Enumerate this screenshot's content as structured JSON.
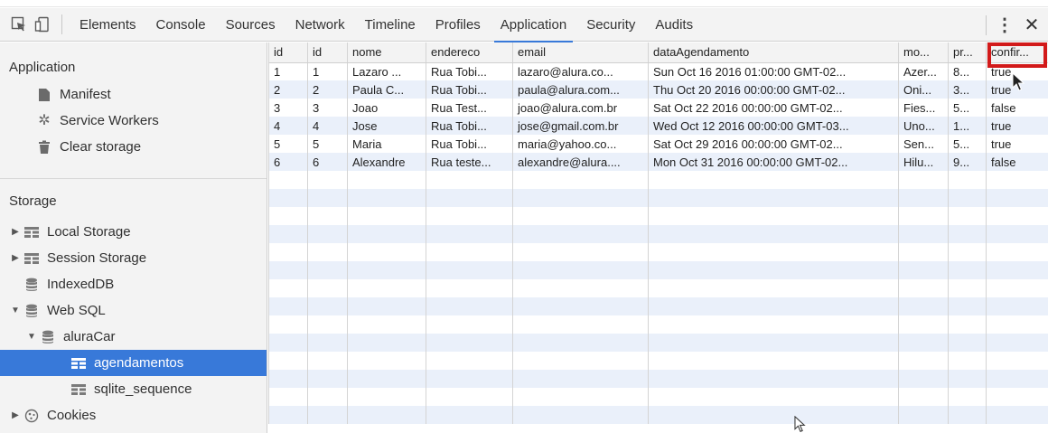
{
  "toolbar": {
    "tabs": [
      "Elements",
      "Console",
      "Sources",
      "Network",
      "Timeline",
      "Profiles",
      "Application",
      "Security",
      "Audits"
    ],
    "active_tab": "Application"
  },
  "sidebar": {
    "application_title": "Application",
    "application_items": [
      "Manifest",
      "Service Workers",
      "Clear storage"
    ],
    "storage_title": "Storage",
    "storage_items": {
      "local_storage": "Local Storage",
      "session_storage": "Session Storage",
      "indexeddb": "IndexedDB",
      "web_sql": "Web SQL",
      "database": "aluraCar",
      "table_selected": "agendamentos",
      "table_other": "sqlite_sequence",
      "cookies": "Cookies"
    }
  },
  "grid": {
    "columns": [
      "id",
      "id",
      "nome",
      "endereco",
      "email",
      "dataAgendamento",
      "mo...",
      "pr...",
      "confir..."
    ],
    "rows": [
      [
        "1",
        "1",
        "Lazaro ...",
        "Rua Tobi...",
        "lazaro@alura.co...",
        "Sun Oct 16 2016 01:00:00 GMT-02...",
        "Azer...",
        "8...",
        "true"
      ],
      [
        "2",
        "2",
        "Paula C...",
        "Rua Tobi...",
        "paula@alura.com...",
        "Thu Oct 20 2016 00:00:00 GMT-02...",
        "Oni...",
        "3...",
        "true"
      ],
      [
        "3",
        "3",
        "Joao",
        "Rua Test...",
        "joao@alura.com.br",
        "Sat Oct 22 2016 00:00:00 GMT-02...",
        "Fies...",
        "5...",
        "false"
      ],
      [
        "4",
        "4",
        "Jose",
        "Rua Tobi...",
        "jose@gmail.com.br",
        "Wed Oct 12 2016 00:00:00 GMT-03...",
        "Uno...",
        "1...",
        "true"
      ],
      [
        "5",
        "5",
        "Maria",
        "Rua Tobi...",
        "maria@yahoo.co...",
        "Sat Oct 29 2016 00:00:00 GMT-02...",
        "Sen...",
        "5...",
        "true"
      ],
      [
        "6",
        "6",
        "Alexandre",
        "Rua teste...",
        "alexandre@alura....",
        "Mon Oct 31 2016 00:00:00 GMT-02...",
        "Hilu...",
        "9...",
        "false"
      ]
    ]
  },
  "colors": {
    "accent": "#3879d9",
    "highlight_box": "#d21a1a",
    "stripe": "#eaf0fa"
  },
  "icons": [
    "inspect-icon",
    "device-icon",
    "kebab-icon",
    "close-icon",
    "manifest-icon",
    "gear-icon",
    "trash-icon",
    "grid-icon",
    "database-icon",
    "cookie-icon"
  ]
}
